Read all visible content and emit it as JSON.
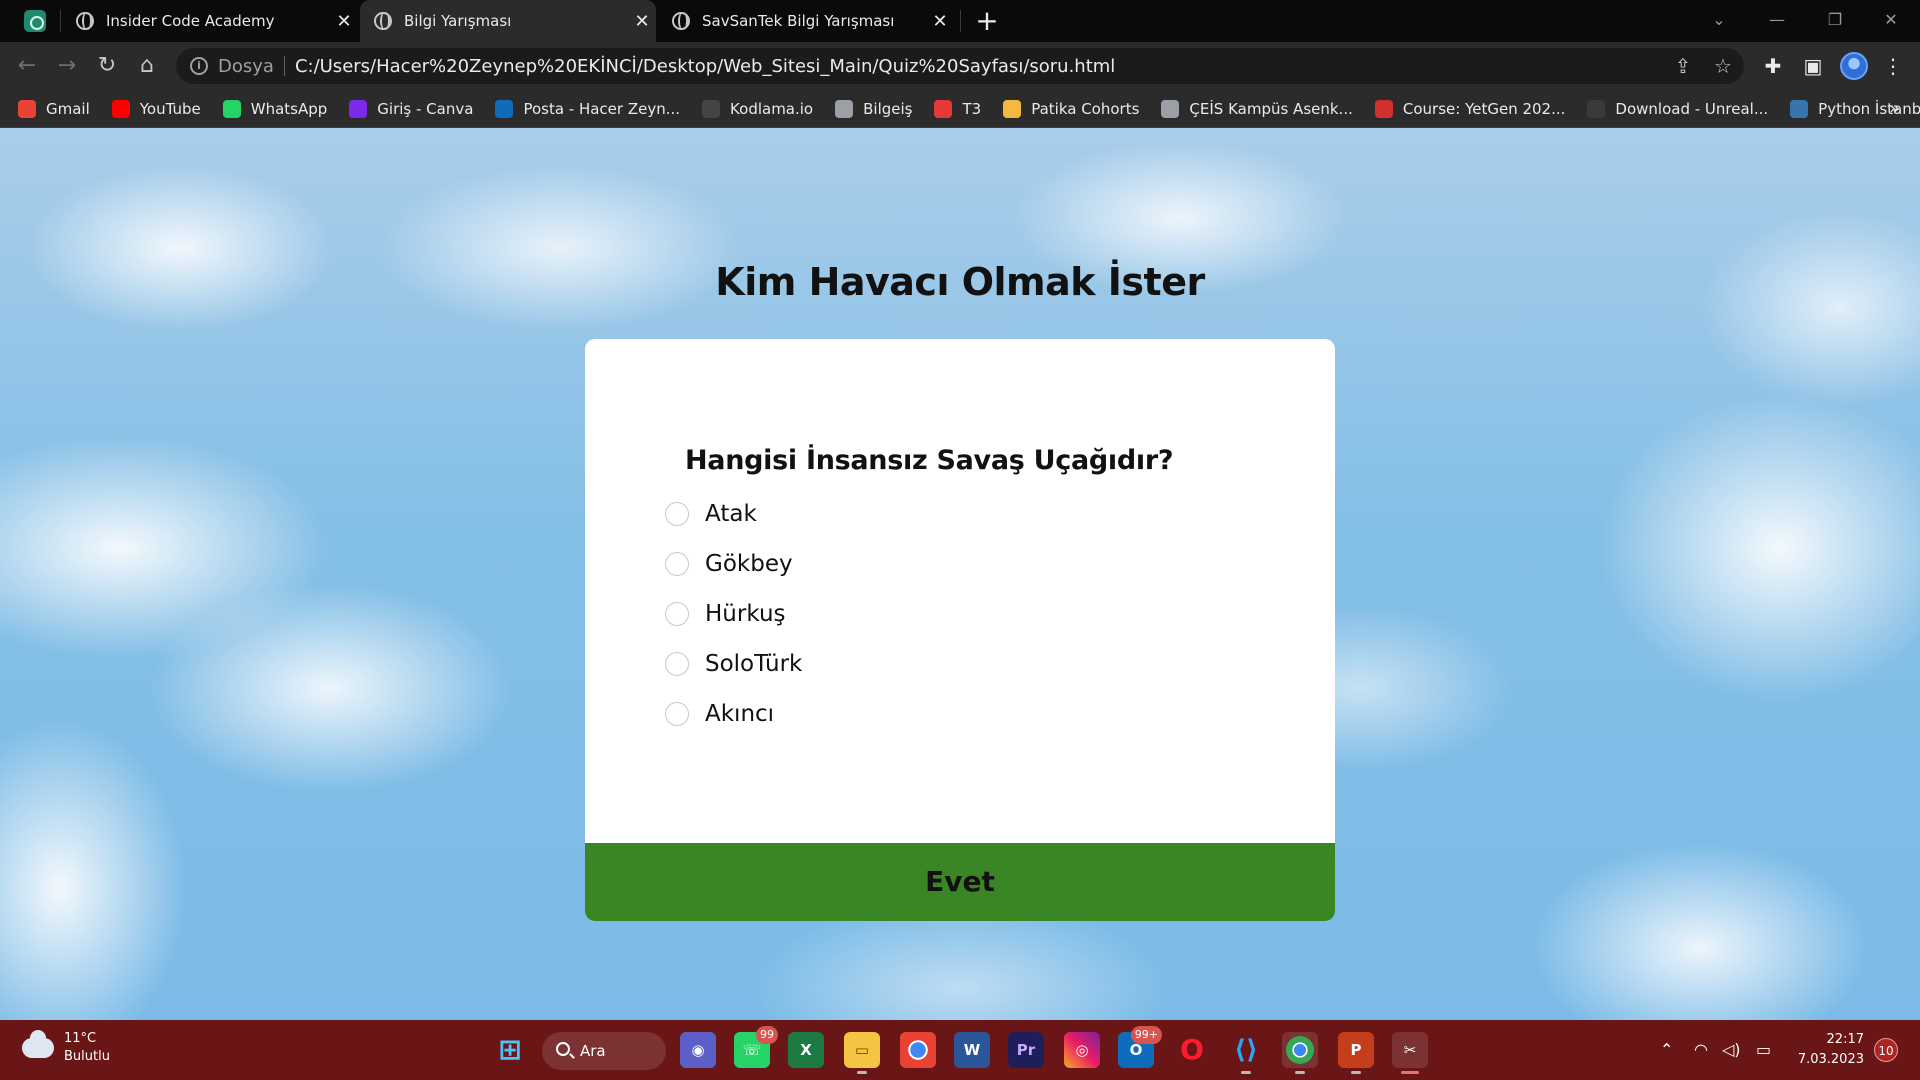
{
  "browser": {
    "tabs": [
      {
        "label": "Insider Code Academy"
      },
      {
        "label": "Bilgi Yarışması"
      },
      {
        "label": "SavSanTek Bilgi Yarışması"
      }
    ],
    "address": {
      "scheme_label": "Dosya",
      "url": "C:/Users/Hacer%20Zeynep%20EKİNCİ/Desktop/Web_Sitesi_Main/Quiz%20Sayfası/soru.html"
    },
    "bookmarks": [
      {
        "label": "Gmail",
        "color": "#ea4335"
      },
      {
        "label": "YouTube",
        "color": "#ff0000"
      },
      {
        "label": "WhatsApp",
        "color": "#25d366"
      },
      {
        "label": "Giriş - Canva",
        "color": "#7d2ae8"
      },
      {
        "label": "Posta - Hacer Zeyn...",
        "color": "#0f6cbd"
      },
      {
        "label": "Kodlama.io",
        "color": "#444444"
      },
      {
        "label": "Bilgeiş",
        "color": "#9aa0a6"
      },
      {
        "label": "T3",
        "color": "#e53935"
      },
      {
        "label": "Patika Cohorts",
        "color": "#f5b942"
      },
      {
        "label": "ÇEİS Kampüs Asenk...",
        "color": "#9aa0a6"
      },
      {
        "label": "Course: YetGen 202...",
        "color": "#d32f2f"
      },
      {
        "label": "Download - Unreal...",
        "color": "#3a3a3a"
      },
      {
        "label": "Python İstanbul",
        "color": "#3776ab"
      }
    ]
  },
  "quiz": {
    "title": "Kim Havacı Olmak İster",
    "question": "Hangisi İnsansız Savaş Uçağıdır?",
    "options": [
      "Atak",
      "Gökbey",
      "Hürkuş",
      "SoloTürk",
      "Akıncı"
    ],
    "submit_label": "Evet",
    "accent_color": "#3a8524"
  },
  "taskbar": {
    "weather": {
      "temp": "11°C",
      "condition": "Bulutlu"
    },
    "search_label": "Ara",
    "badges": {
      "whatsapp": "99",
      "outlook": "99+"
    },
    "clock": {
      "time": "22:17",
      "date": "7.03.2023"
    },
    "notifications": "10"
  }
}
